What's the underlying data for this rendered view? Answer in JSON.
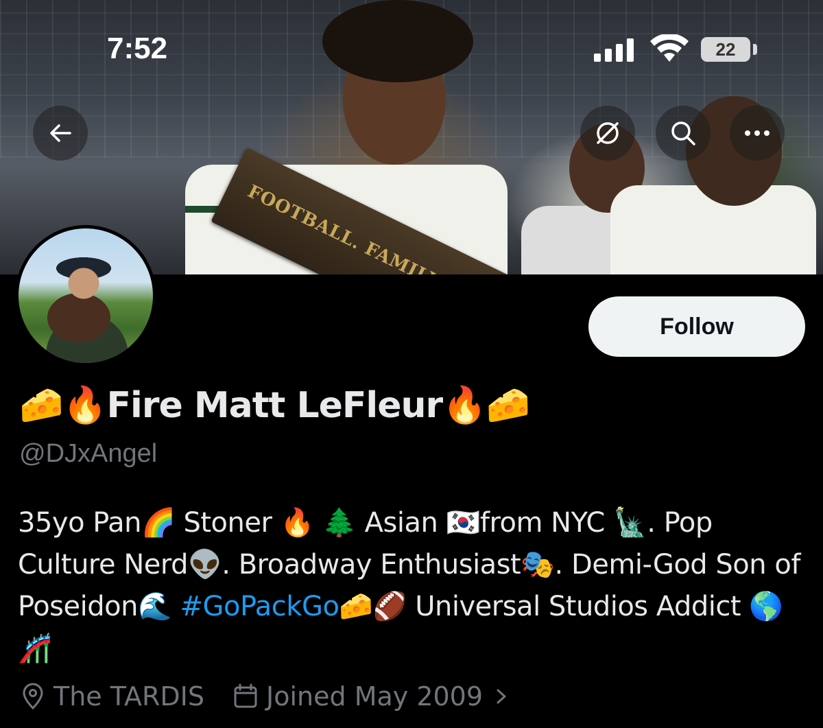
{
  "status_bar": {
    "time": "7:52",
    "battery": "22"
  },
  "banner": {
    "plaque_text": "FOOTBALL. FAMILY. FOO"
  },
  "profile": {
    "follow_label": "Follow",
    "display_name": "🧀🔥Fire Matt LeFleur🔥🧀",
    "handle": "@DJxAngel",
    "bio_before_hashtag": "35yo Pan🌈 Stoner 🔥 🌲 Asian 🇰🇷from NYC 🗽. Pop Culture Nerd👽. Broadway Enthusiast🎭. Demi-God Son of Poseidon🌊 ",
    "hashtag": "#GoPackGo",
    "bio_after_hashtag": "🧀🏈 Universal Studios Addict 🌎 🎢",
    "location": "The TARDIS",
    "joined": "Joined May 2009"
  },
  "colors": {
    "background": "#000000",
    "text_primary": "#e7e9ea",
    "text_secondary": "#71767b",
    "link": "#1d9bf0",
    "follow_bg": "#eff3f4"
  },
  "icons": {
    "back": "arrow-left-icon",
    "translate": "translate-slash-icon",
    "search": "search-icon",
    "more": "more-dots-icon",
    "location": "location-pin-icon",
    "calendar": "calendar-icon",
    "chevron": "chevron-right-icon"
  }
}
